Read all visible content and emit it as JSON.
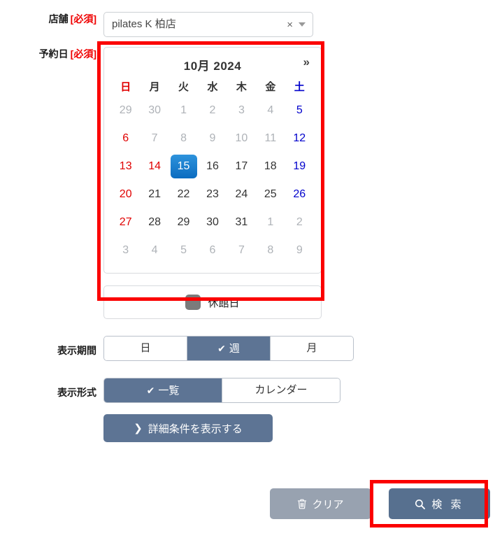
{
  "colors": {
    "accent_slate": "#5d7494",
    "search_button": "#57708f",
    "clear_button": "#98a2b0",
    "annotation_red": "#fb0000",
    "required_red": "#ef0000",
    "sunday_red": "#e00000",
    "saturday_blue": "#0000cc",
    "selected_day_blue": "#0b6cc0",
    "closed_day_gray": "#7b7b7b"
  },
  "store": {
    "label": "店舗",
    "required_tag": "[必須]",
    "selected_value": "pilates K 柏店",
    "clear_icon": "×",
    "caret_icon": "chevron-down"
  },
  "reservation_date": {
    "label": "予約日",
    "required_tag": "[必須]"
  },
  "calendar": {
    "title": "10月 2024",
    "next_label": "»",
    "weekdays": [
      {
        "label": "日",
        "kind": "sun"
      },
      {
        "label": "月",
        "kind": "weekday"
      },
      {
        "label": "火",
        "kind": "weekday"
      },
      {
        "label": "水",
        "kind": "weekday"
      },
      {
        "label": "木",
        "kind": "weekday"
      },
      {
        "label": "金",
        "kind": "weekday"
      },
      {
        "label": "土",
        "kind": "sat"
      }
    ],
    "weeks": [
      [
        {
          "day": "29",
          "state": "muted"
        },
        {
          "day": "30",
          "state": "muted"
        },
        {
          "day": "1",
          "state": "muted"
        },
        {
          "day": "2",
          "state": "muted"
        },
        {
          "day": "3",
          "state": "muted"
        },
        {
          "day": "4",
          "state": "muted"
        },
        {
          "day": "5",
          "state": "sat"
        }
      ],
      [
        {
          "day": "6",
          "state": "sun"
        },
        {
          "day": "7",
          "state": "muted"
        },
        {
          "day": "8",
          "state": "muted"
        },
        {
          "day": "9",
          "state": "muted"
        },
        {
          "day": "10",
          "state": "muted"
        },
        {
          "day": "11",
          "state": "muted"
        },
        {
          "day": "12",
          "state": "sat"
        }
      ],
      [
        {
          "day": "13",
          "state": "sun"
        },
        {
          "day": "14",
          "state": "holiday"
        },
        {
          "day": "15",
          "state": "selected"
        },
        {
          "day": "16",
          "state": "normal"
        },
        {
          "day": "17",
          "state": "normal"
        },
        {
          "day": "18",
          "state": "normal"
        },
        {
          "day": "19",
          "state": "sat"
        }
      ],
      [
        {
          "day": "20",
          "state": "sun"
        },
        {
          "day": "21",
          "state": "normal"
        },
        {
          "day": "22",
          "state": "normal"
        },
        {
          "day": "23",
          "state": "normal"
        },
        {
          "day": "24",
          "state": "normal"
        },
        {
          "day": "25",
          "state": "normal"
        },
        {
          "day": "26",
          "state": "sat"
        }
      ],
      [
        {
          "day": "27",
          "state": "sun"
        },
        {
          "day": "28",
          "state": "normal"
        },
        {
          "day": "29",
          "state": "normal"
        },
        {
          "day": "30",
          "state": "normal"
        },
        {
          "day": "31",
          "state": "normal"
        },
        {
          "day": "1",
          "state": "muted"
        },
        {
          "day": "2",
          "state": "muted"
        }
      ],
      [
        {
          "day": "3",
          "state": "muted"
        },
        {
          "day": "4",
          "state": "muted"
        },
        {
          "day": "5",
          "state": "muted"
        },
        {
          "day": "6",
          "state": "muted"
        },
        {
          "day": "7",
          "state": "muted"
        },
        {
          "day": "8",
          "state": "muted"
        },
        {
          "day": "9",
          "state": "muted"
        }
      ]
    ],
    "legend": {
      "swatch_name": "closed-day-swatch",
      "label": "休館日"
    }
  },
  "display_period": {
    "label": "表示期間",
    "options": [
      {
        "label": "日",
        "active": false
      },
      {
        "label": "週",
        "active": true
      },
      {
        "label": "月",
        "active": false
      }
    ],
    "check_icon": "✔"
  },
  "display_format": {
    "label": "表示形式",
    "options": [
      {
        "label": "一覧",
        "active": true
      },
      {
        "label": "カレンダー",
        "active": false
      }
    ],
    "check_icon": "✔"
  },
  "detail_button": {
    "chevron_icon": "❯",
    "label": "詳細条件を表示する"
  },
  "actions": {
    "clear_label": "クリア",
    "clear_icon": "trash-icon",
    "search_label": "検 索",
    "search_icon": "magnifier-icon"
  }
}
